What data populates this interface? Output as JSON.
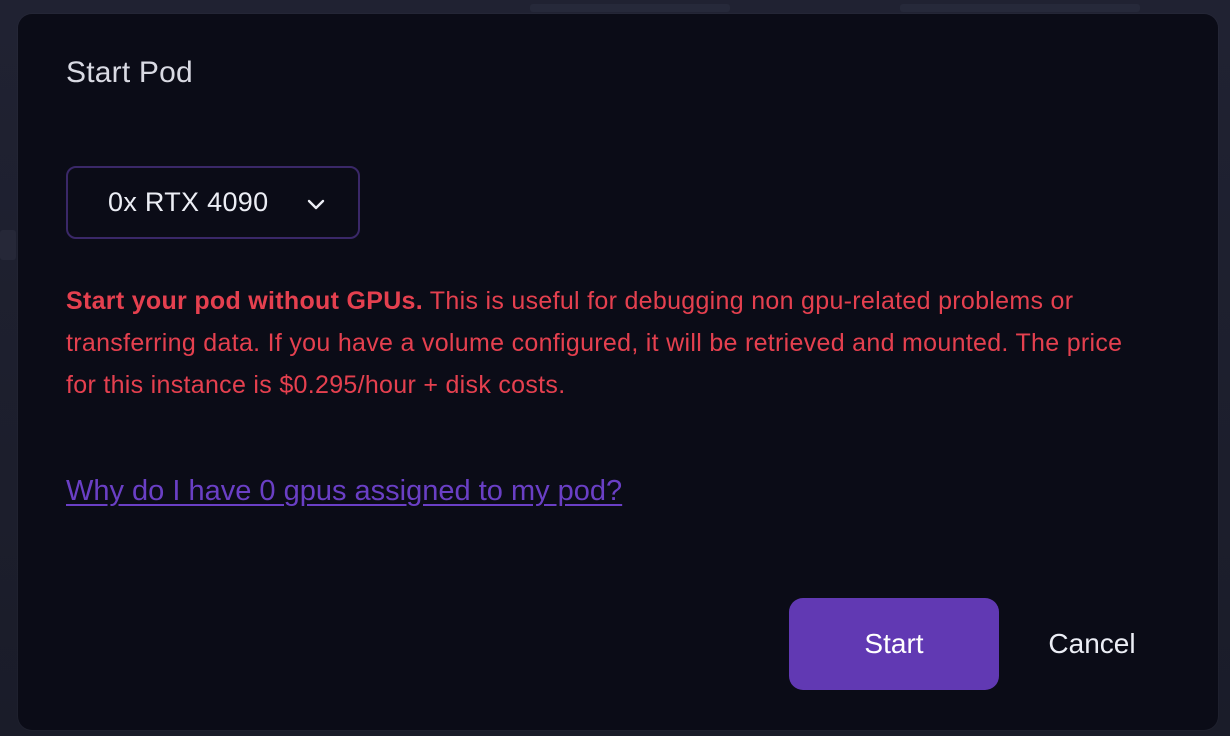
{
  "modal": {
    "title": "Start Pod",
    "gpu_select": {
      "selected": "0x RTX 4090",
      "icon": "chevron-down-icon"
    },
    "warning": {
      "strong": "Start your pod without GPUs.",
      "text": " This is useful for debugging non gpu-related problems or transferring data. If you have a volume configured, it will be retrieved and mounted. The price for this instance is $0.295/hour + disk costs."
    },
    "help_link": "Why do I have 0 gpus assigned to my pod?",
    "actions": {
      "start_label": "Start",
      "cancel_label": "Cancel"
    }
  },
  "colors": {
    "modal_background": "#0b0c17",
    "warning": "#e5404f",
    "link": "#6a3fc5",
    "primary_button": "#6139b3",
    "select_border": "#3a2868"
  }
}
